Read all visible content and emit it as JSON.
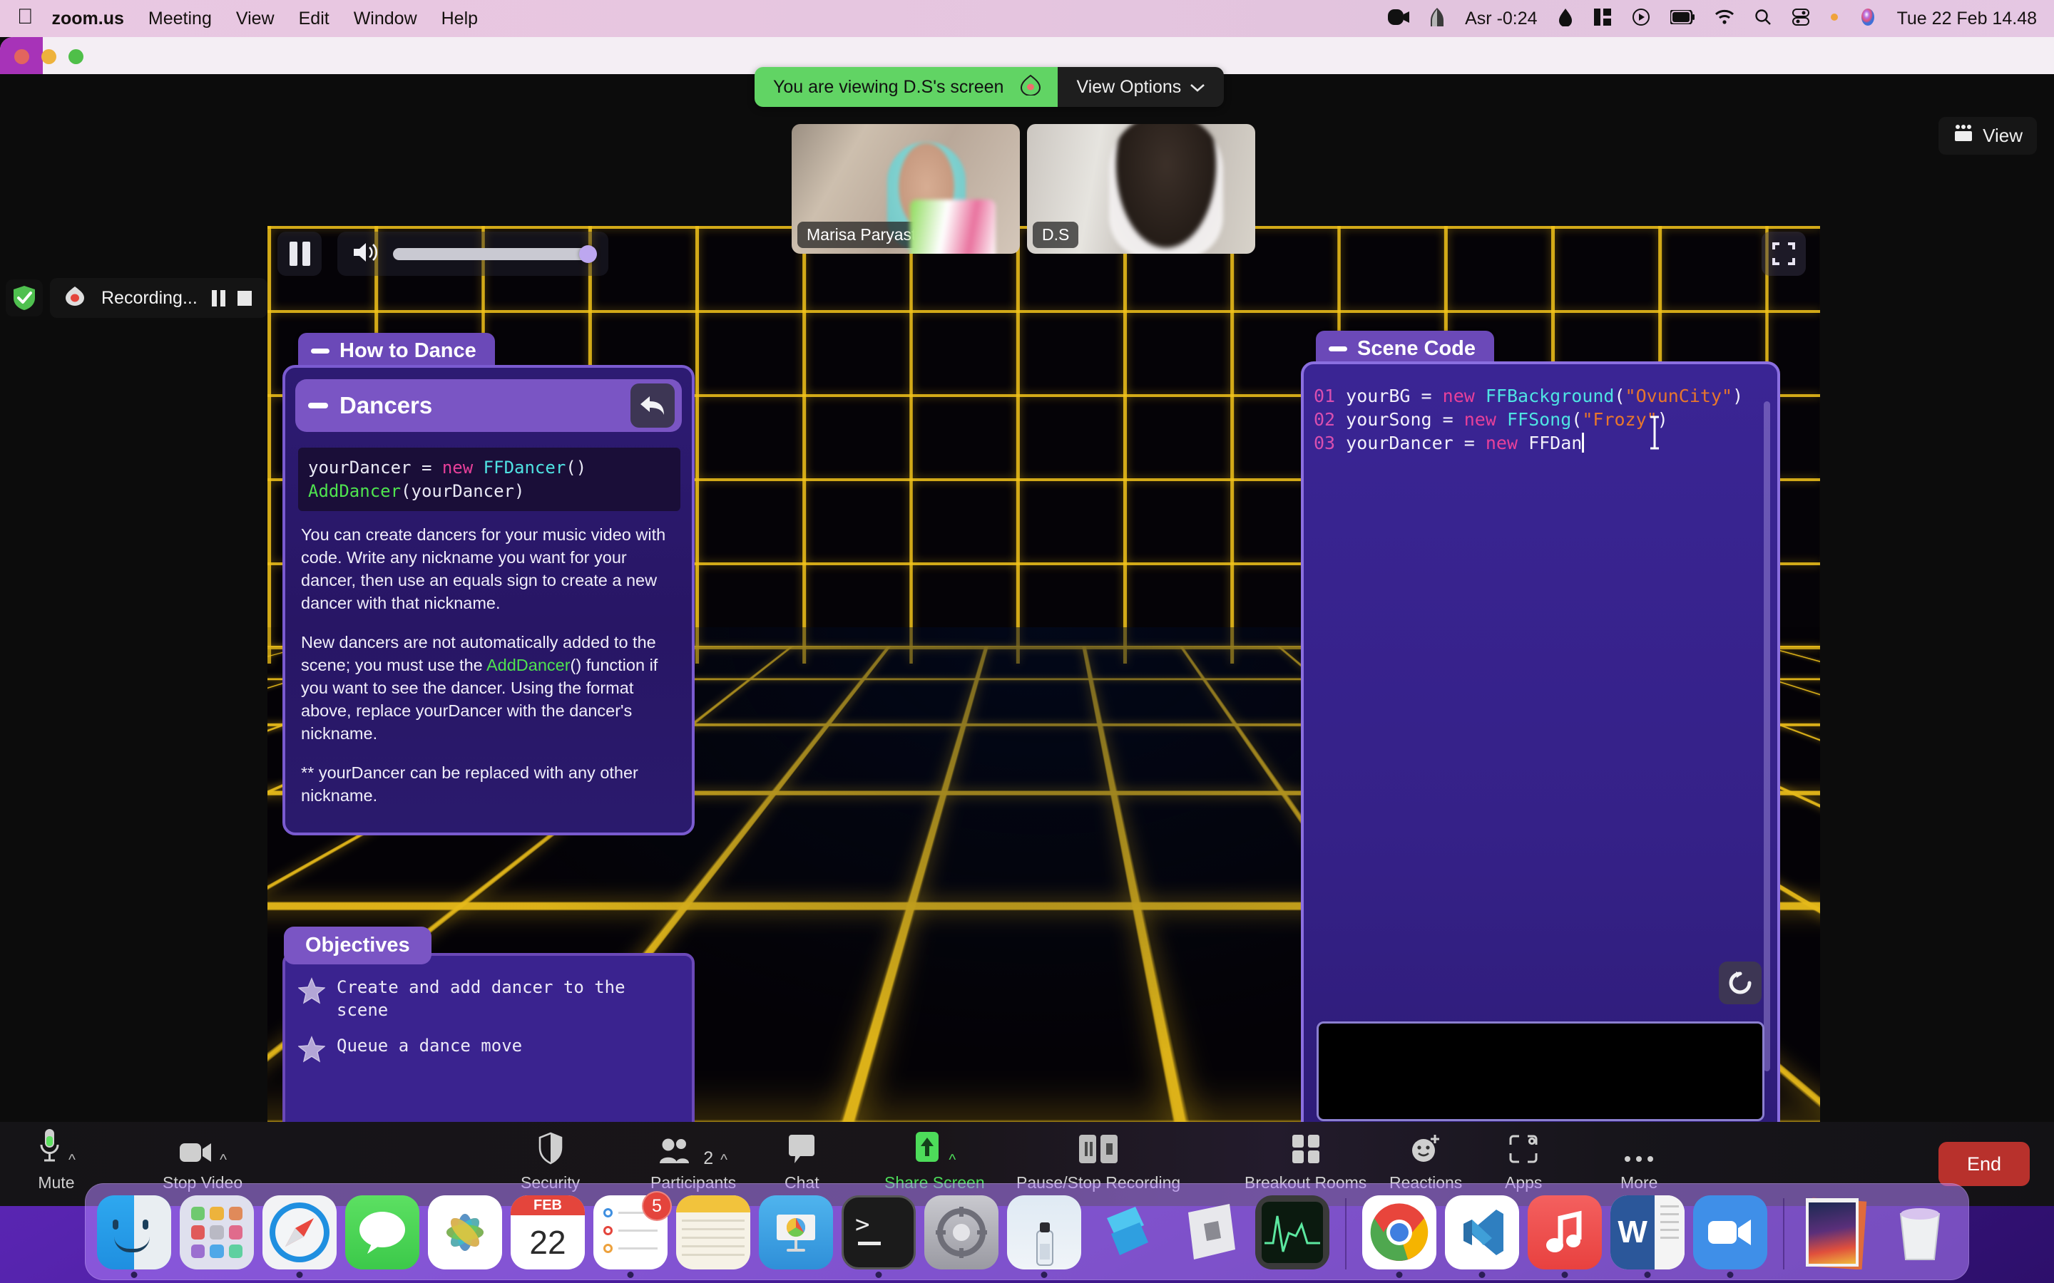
{
  "menubar": {
    "apple_icon": "apple-logo-icon",
    "app_name": "zoom.us",
    "items": [
      "Meeting",
      "View",
      "Edit",
      "Window",
      "Help"
    ],
    "tray": {
      "video_icon": "zoom-camera-icon",
      "prayer_icon": "mosque-icon",
      "prayer_label": "Asr -0:24",
      "drop_icon": "water-drop-icon",
      "stats_icon": "stats-bars-icon",
      "play_icon": "play-circle-icon",
      "battery_icon": "battery-icon",
      "wifi_icon": "wifi-icon",
      "search_icon": "search-icon",
      "control_center_icon": "control-center-icon",
      "siri_icon": "siri-icon",
      "clock": "Tue 22 Feb  14.48"
    }
  },
  "window": {
    "traffic_lights": [
      "close-button",
      "minimize-button",
      "zoom-button"
    ]
  },
  "banner": {
    "text": "You are viewing D.S's screen",
    "leaf_icon": "screen-share-leaf-icon",
    "view_options_label": "View Options",
    "chevron_icon": "chevron-down-icon"
  },
  "view_button": {
    "label": "View",
    "icon": "grid-view-icon"
  },
  "participants_thumbs": [
    {
      "name": "Marisa Paryasto"
    },
    {
      "name": "D.S"
    }
  ],
  "recording": {
    "shield_icon": "security-shield-check-icon",
    "rec_icon": "recording-dot-icon",
    "label": "Recording...",
    "pause_icon": "pause-icon",
    "stop_icon": "stop-icon"
  },
  "player": {
    "pause_icon": "pause-icon",
    "volume_icon": "volume-speaker-icon",
    "volume_percent": 100,
    "expand_icon": "fullscreen-expand-icon"
  },
  "game": {
    "how_to_dance_tab": "How to Dance",
    "scene_code_tab": "Scene Code",
    "dancers_panel": {
      "title": "Dancers",
      "back_icon": "back-arrow-icon",
      "snippet": {
        "line1_var": "yourDancer",
        "line1_eq": " = ",
        "line1_new": "new",
        "line1_type": "FFDancer",
        "line1_parens": "()",
        "line2_fn": "AddDancer",
        "line2_arg": "(yourDancer)"
      },
      "paragraphs": [
        "You can create dancers for your music video with code. Write any nickname you want for your dancer, then use an equals sign to create a new dancer with that nickname.",
        "New dancers are not automatically added to the scene; you must use the AddDancer() function if you want to see the dancer. Using the format above, replace yourDancer with the dancer's nickname.",
        "** yourDancer can be replaced with any other nickname."
      ],
      "para2_pre": "New dancers are not automatically added to the scene; you must use the ",
      "para2_fn": "AddDancer",
      "para2_post": "() function if you want to see the dancer. Using the format above, replace yourDancer with the dancer's nickname."
    },
    "objectives": {
      "tab_label": "Objectives",
      "items": [
        {
          "star_icon": "star-icon",
          "text": "Create and add dancer to the scene"
        },
        {
          "star_icon": "star-icon",
          "text": "Queue a dance move"
        }
      ]
    },
    "scene_code": {
      "lines": [
        {
          "num": "01",
          "var": "yourBG",
          "eq": " = ",
          "kw": "new",
          "type": "FFBackground",
          "open": "(",
          "str": "\"OvunCity\"",
          "close": ")"
        },
        {
          "num": "02",
          "var": "yourSong",
          "eq": " = ",
          "kw": "new",
          "type": "FFSong",
          "open": "(",
          "str": "\"Frozy\"",
          "close": ")"
        },
        {
          "num": "03",
          "var": "yourDancer",
          "eq": " = ",
          "kw": "new",
          "type": "FFDan",
          "open": "",
          "str": "",
          "close": ""
        }
      ],
      "refresh_icon": "reset-refresh-icon",
      "cursor_icon": "text-ibeam-cursor",
      "console_text": ""
    }
  },
  "toolbar": {
    "items": [
      {
        "label": "Mute",
        "icon": "microphone-icon",
        "caret": true,
        "accent": false
      },
      {
        "label": "Stop Video",
        "icon": "video-camera-icon",
        "caret": true,
        "accent": false
      },
      {
        "label": "Security",
        "icon": "shield-icon",
        "caret": false,
        "accent": false
      },
      {
        "label": "Participants",
        "icon": "participants-icon",
        "caret": true,
        "accent": false,
        "count": "2"
      },
      {
        "label": "Chat",
        "icon": "chat-bubble-icon",
        "caret": false,
        "accent": false
      },
      {
        "label": "Share Screen",
        "icon": "share-screen-up-arrow-icon",
        "caret": true,
        "accent": true
      },
      {
        "label": "Pause/Stop Recording",
        "icon": "pause-stop-recording-icon",
        "caret": false,
        "accent": false
      },
      {
        "label": "Breakout Rooms",
        "icon": "breakout-rooms-grid-icon",
        "caret": false,
        "accent": false
      },
      {
        "label": "Reactions",
        "icon": "reactions-smiley-plus-icon",
        "caret": false,
        "accent": false
      },
      {
        "label": "Apps",
        "icon": "apps-icon",
        "caret": false,
        "accent": false
      },
      {
        "label": "More",
        "icon": "more-ellipsis-icon",
        "caret": false,
        "accent": false
      }
    ],
    "end_label": "End"
  },
  "dock": {
    "apps": [
      {
        "name": "finder-icon",
        "running": true
      },
      {
        "name": "launchpad-icon",
        "running": false
      },
      {
        "name": "safari-icon",
        "running": true
      },
      {
        "name": "messages-icon",
        "running": false
      },
      {
        "name": "photos-icon",
        "running": false
      },
      {
        "name": "calendar-icon",
        "running": false,
        "month": "FEB",
        "day": "22"
      },
      {
        "name": "reminders-icon",
        "running": true,
        "badge": "5"
      },
      {
        "name": "notes-icon",
        "running": false
      },
      {
        "name": "keynote-icon",
        "running": false
      },
      {
        "name": "terminal-icon",
        "running": true
      },
      {
        "name": "system-preferences-icon",
        "running": false
      },
      {
        "name": "preview-icon",
        "running": true
      },
      {
        "name": "roblox-studio-icon",
        "running": false
      },
      {
        "name": "roblox-icon",
        "running": false
      },
      {
        "name": "activity-monitor-icon",
        "running": false
      },
      {
        "name": "chrome-icon",
        "running": true
      },
      {
        "name": "vscode-icon",
        "running": true
      },
      {
        "name": "music-icon",
        "running": true
      },
      {
        "name": "word-icon",
        "running": true
      },
      {
        "name": "zoom-icon",
        "running": true
      },
      {
        "name": "document-stack-icon",
        "running": false
      },
      {
        "name": "trash-icon",
        "running": false
      }
    ]
  }
}
